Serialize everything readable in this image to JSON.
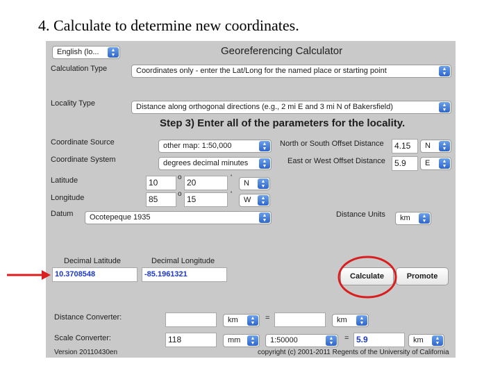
{
  "slide": {
    "title": "4. Calculate to determine new coordinates."
  },
  "app": {
    "title": "Georeferencing Calculator",
    "language": "English (lo...",
    "step_heading": "Step 3) Enter all of the parameters for the locality."
  },
  "form": {
    "calculation_type_label": "Calculation Type",
    "calculation_type_value": "Coordinates only - enter the Lat/Long for the named place or starting point",
    "locality_type_label": "Locality Type",
    "locality_type_value": "Distance along orthogonal directions (e.g., 2 mi E and 3 mi N of Bakersfield)",
    "coordinate_source_label": "Coordinate Source",
    "coordinate_source_value": "other map: 1:50,000",
    "coordinate_system_label": "Coordinate System",
    "coordinate_system_value": "degrees decimal minutes",
    "ns_offset_label": "North or South Offset Distance",
    "ns_offset_value": "4.15",
    "ns_dir": "N",
    "ew_offset_label": "East or West Offset Distance",
    "ew_offset_value": "5.9",
    "ew_dir": "E",
    "latitude_label": "Latitude",
    "lat_deg": "10",
    "lat_min": "20",
    "lat_dir": "N",
    "longitude_label": "Longitude",
    "lon_deg": "85",
    "lon_min": "15",
    "lon_dir": "W",
    "degree_symbol": "o",
    "minute_symbol": "'",
    "datum_label": "Datum",
    "datum_value": "Ocotepeque 1935",
    "distance_units_label": "Distance Units",
    "distance_units_value": "km"
  },
  "results": {
    "decimal_latitude_label": "Decimal Latitude",
    "decimal_latitude_value": "10.3708548",
    "decimal_longitude_label": "Decimal Longitude",
    "decimal_longitude_value": "-85.1961321"
  },
  "buttons": {
    "calculate": "Calculate",
    "promote": "Promote"
  },
  "converters": {
    "distance_label": "Distance Converter:",
    "distance_from_value": "",
    "distance_from_unit": "km",
    "equals": "=",
    "distance_to_value": "",
    "distance_to_unit": "km",
    "scale_label": "Scale Converter:",
    "scale_value": "118",
    "scale_unit": "mm",
    "scale_ratio": "1:50000",
    "scale_result": "5.9",
    "scale_result_unit": "km"
  },
  "footer": {
    "version": "Version 20110430en",
    "copyright": "copyright (c) 2001-2011 Regents of the University of California"
  },
  "colors": {
    "panel_bg": "#c9c9c9",
    "result_text": "#1b38c8",
    "highlight_circle": "#d81e1e",
    "arrow": "#d81e1e",
    "dropdown_arrow": "#2f66cc"
  }
}
